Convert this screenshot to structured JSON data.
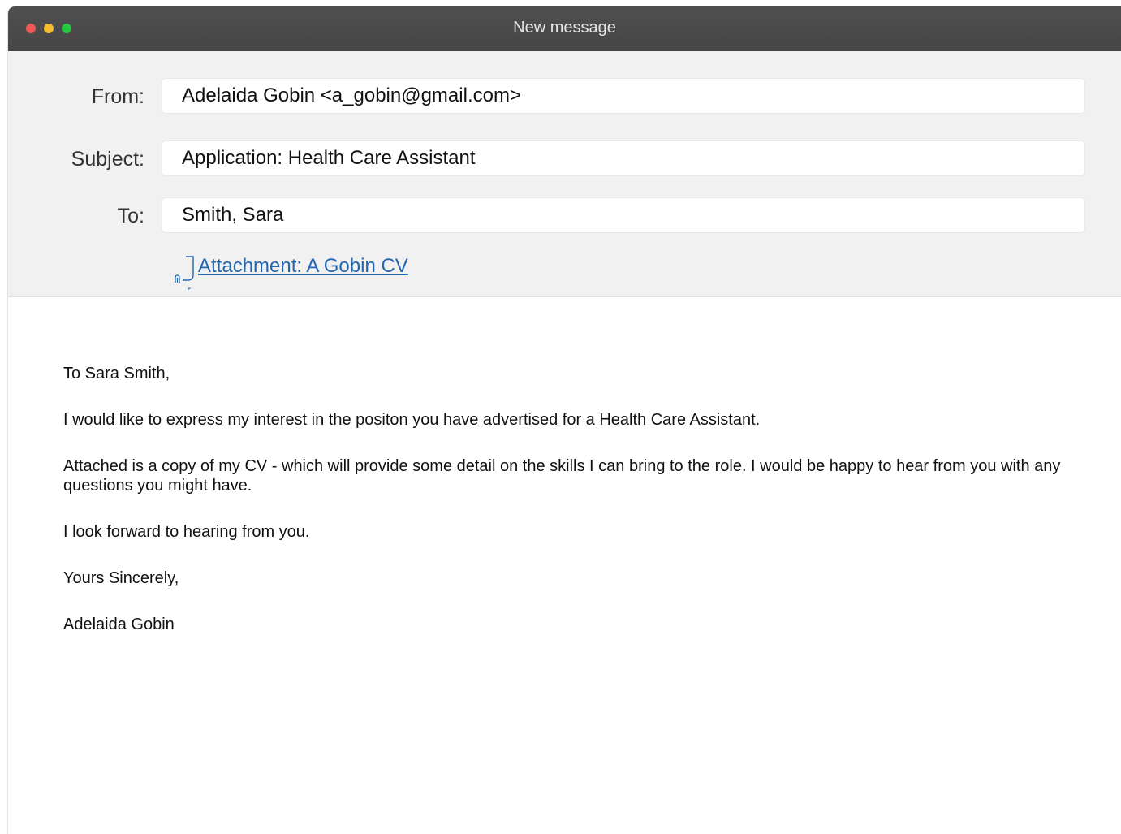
{
  "window": {
    "title": "New message"
  },
  "fields": {
    "from": {
      "label": "From:",
      "value": "Adelaida Gobin <a_gobin@gmail.com>"
    },
    "subject": {
      "label": "Subject:",
      "value": "Application: Health Care Assistant"
    },
    "to": {
      "label": "To:",
      "value": "Smith, Sara"
    }
  },
  "attachment": {
    "label": "Attachment: A Gobin CV",
    "icon": "paperclip-icon"
  },
  "message": {
    "greeting": "To Sara Smith,",
    "paragraph_1": "I would like to express my interest in the positon you have advertised for a Health Care Assistant.",
    "paragraph_2": "Attached is a copy of my CV - which will provide some detail on the skills I can bring to the role. I would be happy to hear from you with any questions you might have.",
    "paragraph_3": "I look forward to hearing from you.",
    "closing": "Yours Sincerely,",
    "signature": "Adelaida Gobin"
  },
  "colors": {
    "titlebar": "#4a4a4a",
    "header_bg": "#f1f1f1",
    "link": "#2466b0",
    "close": "#ee5a55",
    "minimize": "#f4bd2f",
    "zoom": "#27c840"
  }
}
